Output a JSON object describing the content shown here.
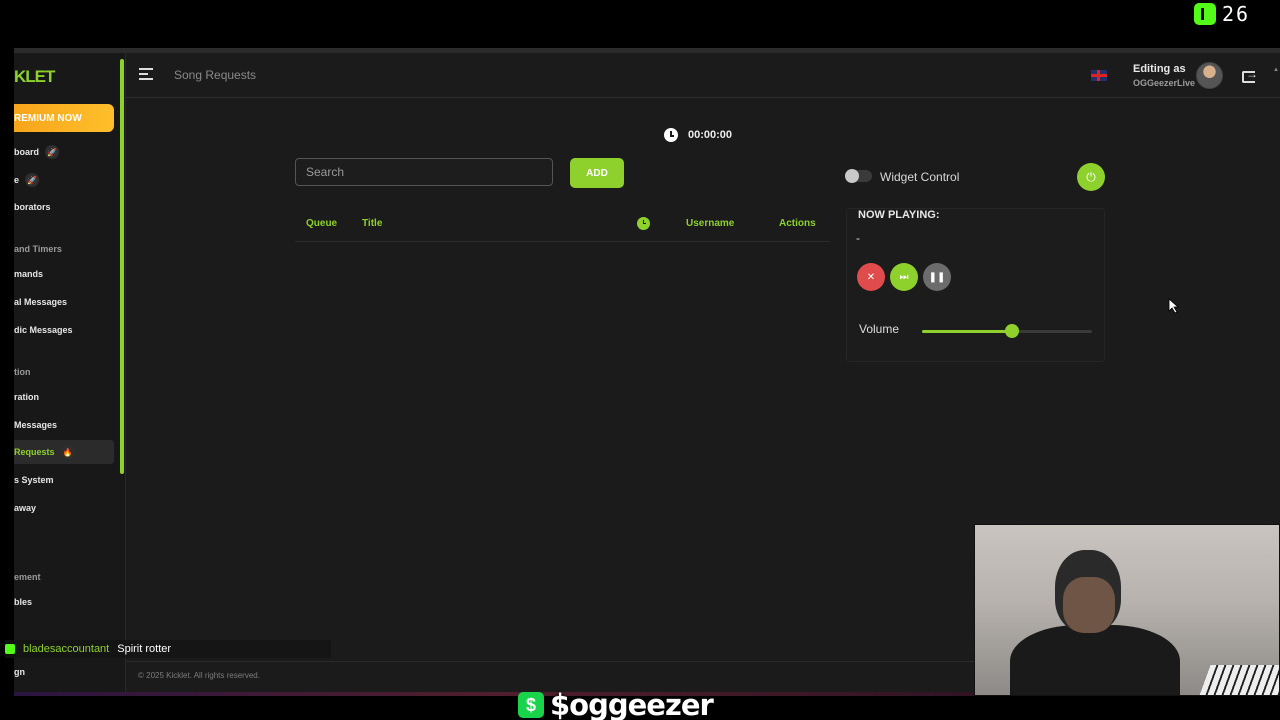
{
  "overlay": {
    "viewer_count": "26",
    "chat_user": "bladesaccountant",
    "chat_message": "Spirit rotter",
    "cashtag": "$oggeezer",
    "cashtag_icon": "$"
  },
  "sidebar": {
    "logo": "KLET",
    "premium_label": "REMIUM NOW",
    "items": [
      {
        "label": "board",
        "badge": "🚀"
      },
      {
        "label": "e",
        "badge": "🚀"
      },
      {
        "label": "borators"
      },
      {
        "label": "mands"
      },
      {
        "label": "al Messages"
      },
      {
        "label": "dic Messages"
      },
      {
        "label": "ration"
      },
      {
        "label": "Messages"
      },
      {
        "label": "Requests",
        "badge": "🔥"
      },
      {
        "label": "s System"
      },
      {
        "label": "away"
      },
      {
        "label": "bles"
      },
      {
        "label": "gn"
      }
    ],
    "sections": [
      "and Timers",
      "tion",
      "ement"
    ]
  },
  "header": {
    "page_title": "Song Requests",
    "editing_label": "Editing as",
    "editing_user": "OGGeezerLive"
  },
  "timer": {
    "value": "00:00:00"
  },
  "search": {
    "placeholder": "Search",
    "add_label": "ADD"
  },
  "table": {
    "columns": [
      "Queue",
      "Title",
      "Username",
      "Actions"
    ]
  },
  "widget": {
    "label": "Widget Control",
    "enabled": false
  },
  "now_playing": {
    "title": "NOW PLAYING:",
    "song": "-",
    "volume_label": "Volume",
    "volume_level": 0.53
  },
  "footer": {
    "copyright": "© 2025 Kicklet. All rights reserved."
  },
  "colors": {
    "accent": "#8fd12c",
    "stop": "#e04b4b",
    "premium": "#f7a51b"
  }
}
